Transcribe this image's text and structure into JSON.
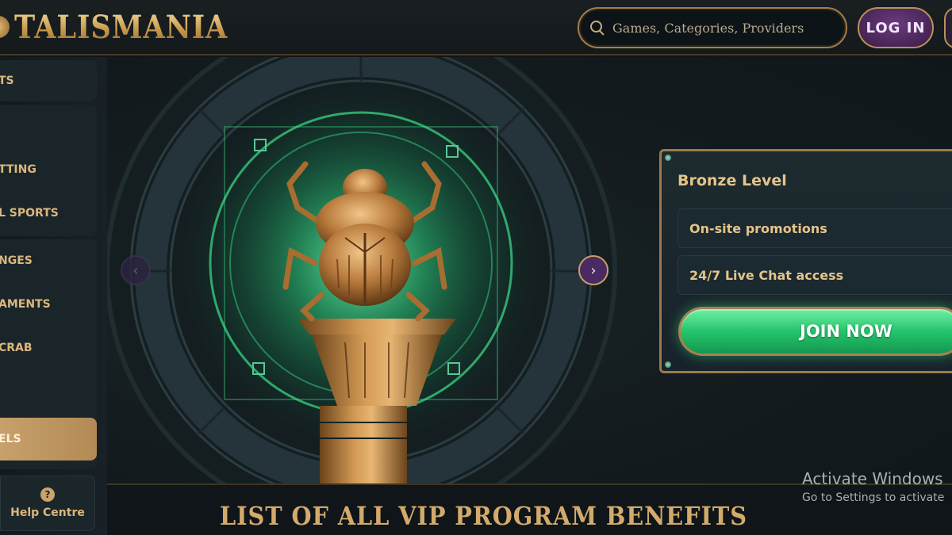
{
  "header": {
    "logo_text": "TALISMANIA",
    "search_placeholder": "Games, Categories, Providers",
    "login_label": "LOG IN"
  },
  "sidebar": {
    "items": [
      {
        "label": "TS"
      },
      {
        "label": "TTING"
      },
      {
        "label": "L SPORTS"
      },
      {
        "label": "NGES"
      },
      {
        "label": "AMENTS"
      },
      {
        "label": "CRAB"
      },
      {
        "label": "ELS"
      }
    ],
    "help_label": "Help Centre",
    "help_icon": "?"
  },
  "hero": {
    "prev_arrow": "‹",
    "next_arrow": "›"
  },
  "level_card": {
    "title": "Bronze Level",
    "benefits": [
      "On-site promotions",
      "24/7 Live Chat access"
    ],
    "join_label": "JOIN NOW"
  },
  "section": {
    "title": "LIST OF ALL VIP PROGRAM BENEFITS"
  },
  "watermark": {
    "title": "Activate Windows",
    "subtitle": "Go to Settings to activate"
  },
  "colors": {
    "accent_gold": "#c9a46c",
    "join_green": "#25c46b",
    "login_purple": "#4a2a62",
    "glow_green": "#3ce08a"
  }
}
